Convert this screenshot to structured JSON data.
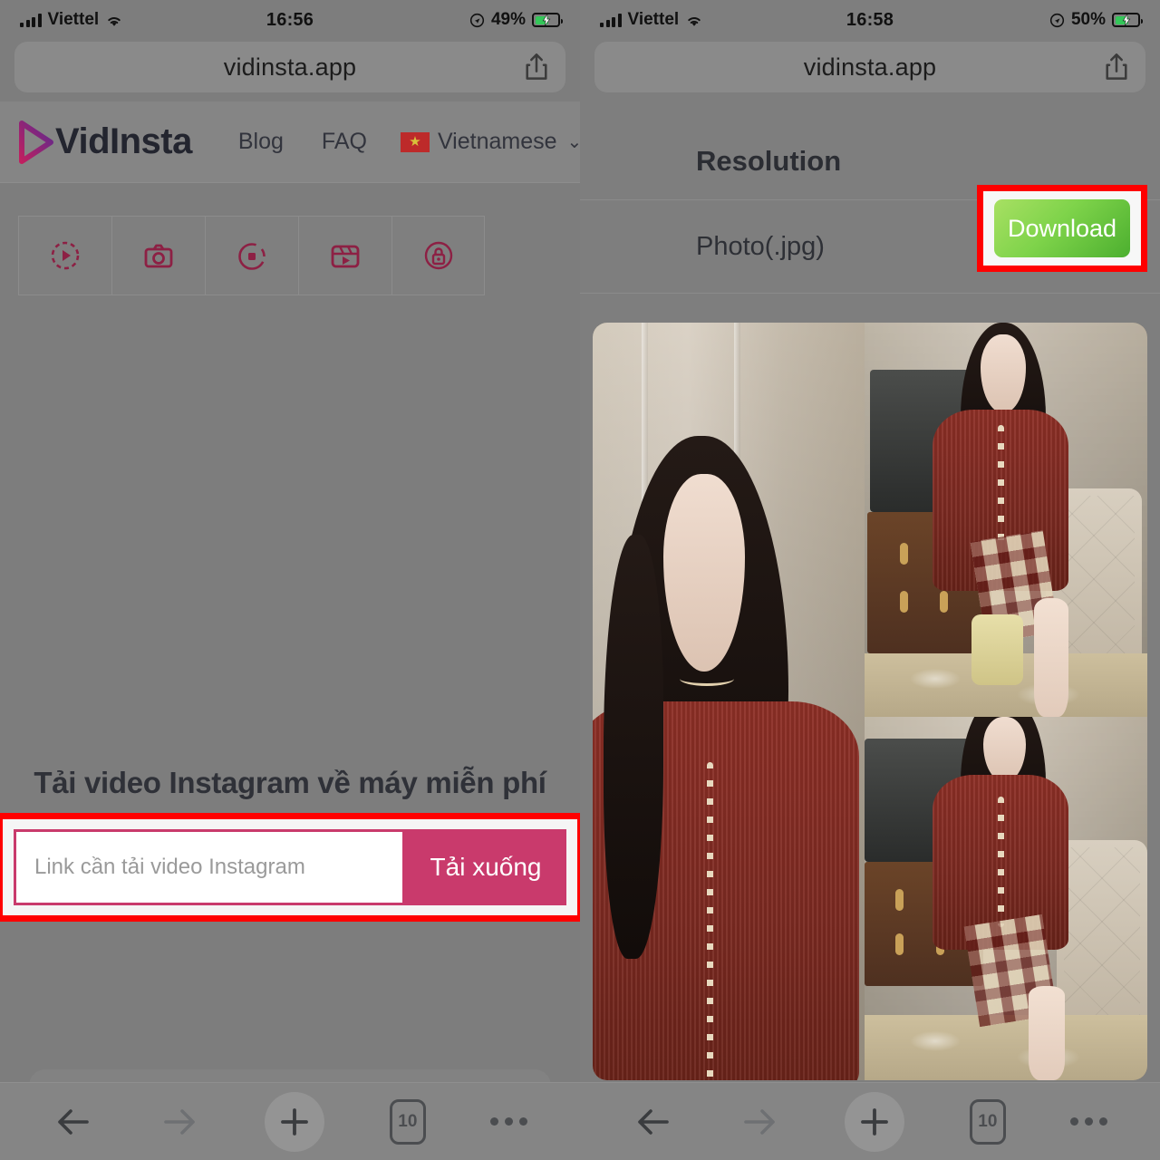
{
  "left": {
    "status": {
      "carrier": "Viettel",
      "time": "16:56",
      "battery_percent": "49%",
      "signal_icon": "cellular-bars-icon",
      "wifi_icon": "wifi-icon",
      "location_icon": "location-arrow-icon",
      "battery_icon": "battery-charging-icon"
    },
    "urlbar": {
      "url": "vidinsta.app",
      "share_icon": "share-icon"
    },
    "site_header": {
      "logo_text": "VidInsta",
      "logo_icon": "play-triangle-icon",
      "nav": [
        {
          "label": "Blog"
        },
        {
          "label": "FAQ"
        }
      ],
      "language": {
        "label": "Vietnamese",
        "flag_icon": "vietnam-flag-icon",
        "chevron_icon": "chevron-down-icon"
      }
    },
    "tabs": [
      {
        "name": "video-tab",
        "icon": "play-circle-dashed-icon"
      },
      {
        "name": "photo-tab",
        "icon": "camera-icon"
      },
      {
        "name": "story-tab",
        "icon": "story-circle-icon"
      },
      {
        "name": "reels-tab",
        "icon": "reels-clapper-icon"
      },
      {
        "name": "private-tab",
        "icon": "lock-circle-icon"
      }
    ],
    "hero": {
      "title": "Tải video Instagram về máy miễn phí",
      "input_placeholder": "Link cần tải video Instagram",
      "input_value": "",
      "button_label": "Tải xuống"
    },
    "bottombar": {
      "back_icon": "arrow-left-icon",
      "forward_icon": "arrow-right-icon",
      "add_icon": "plus-icon",
      "tabs_count": "10",
      "more_icon": "ellipsis-icon"
    }
  },
  "right": {
    "status": {
      "carrier": "Viettel",
      "time": "16:58",
      "battery_percent": "50%",
      "signal_icon": "cellular-bars-icon",
      "wifi_icon": "wifi-icon",
      "location_icon": "location-arrow-icon",
      "battery_icon": "battery-charging-icon"
    },
    "urlbar": {
      "url": "vidinsta.app",
      "share_icon": "share-icon"
    },
    "resolution": {
      "title": "Resolution",
      "row_label": "Photo(.jpg)",
      "download_label": "Download"
    },
    "preview": {
      "alt": "instagram-photo-collage"
    },
    "bottombar": {
      "back_icon": "arrow-left-icon",
      "forward_icon": "arrow-right-icon",
      "add_icon": "plus-icon",
      "tabs_count": "10",
      "more_icon": "ellipsis-icon"
    }
  },
  "colors": {
    "brand_pink": "#c93a6c",
    "brand_purple": "#6b2a8f",
    "brand_dark": "#8d2044",
    "annotation_red": "#ff0000",
    "download_green": "#7ed34a",
    "battery_green": "#34c759",
    "overlay_gray": "#7e7e7e"
  }
}
